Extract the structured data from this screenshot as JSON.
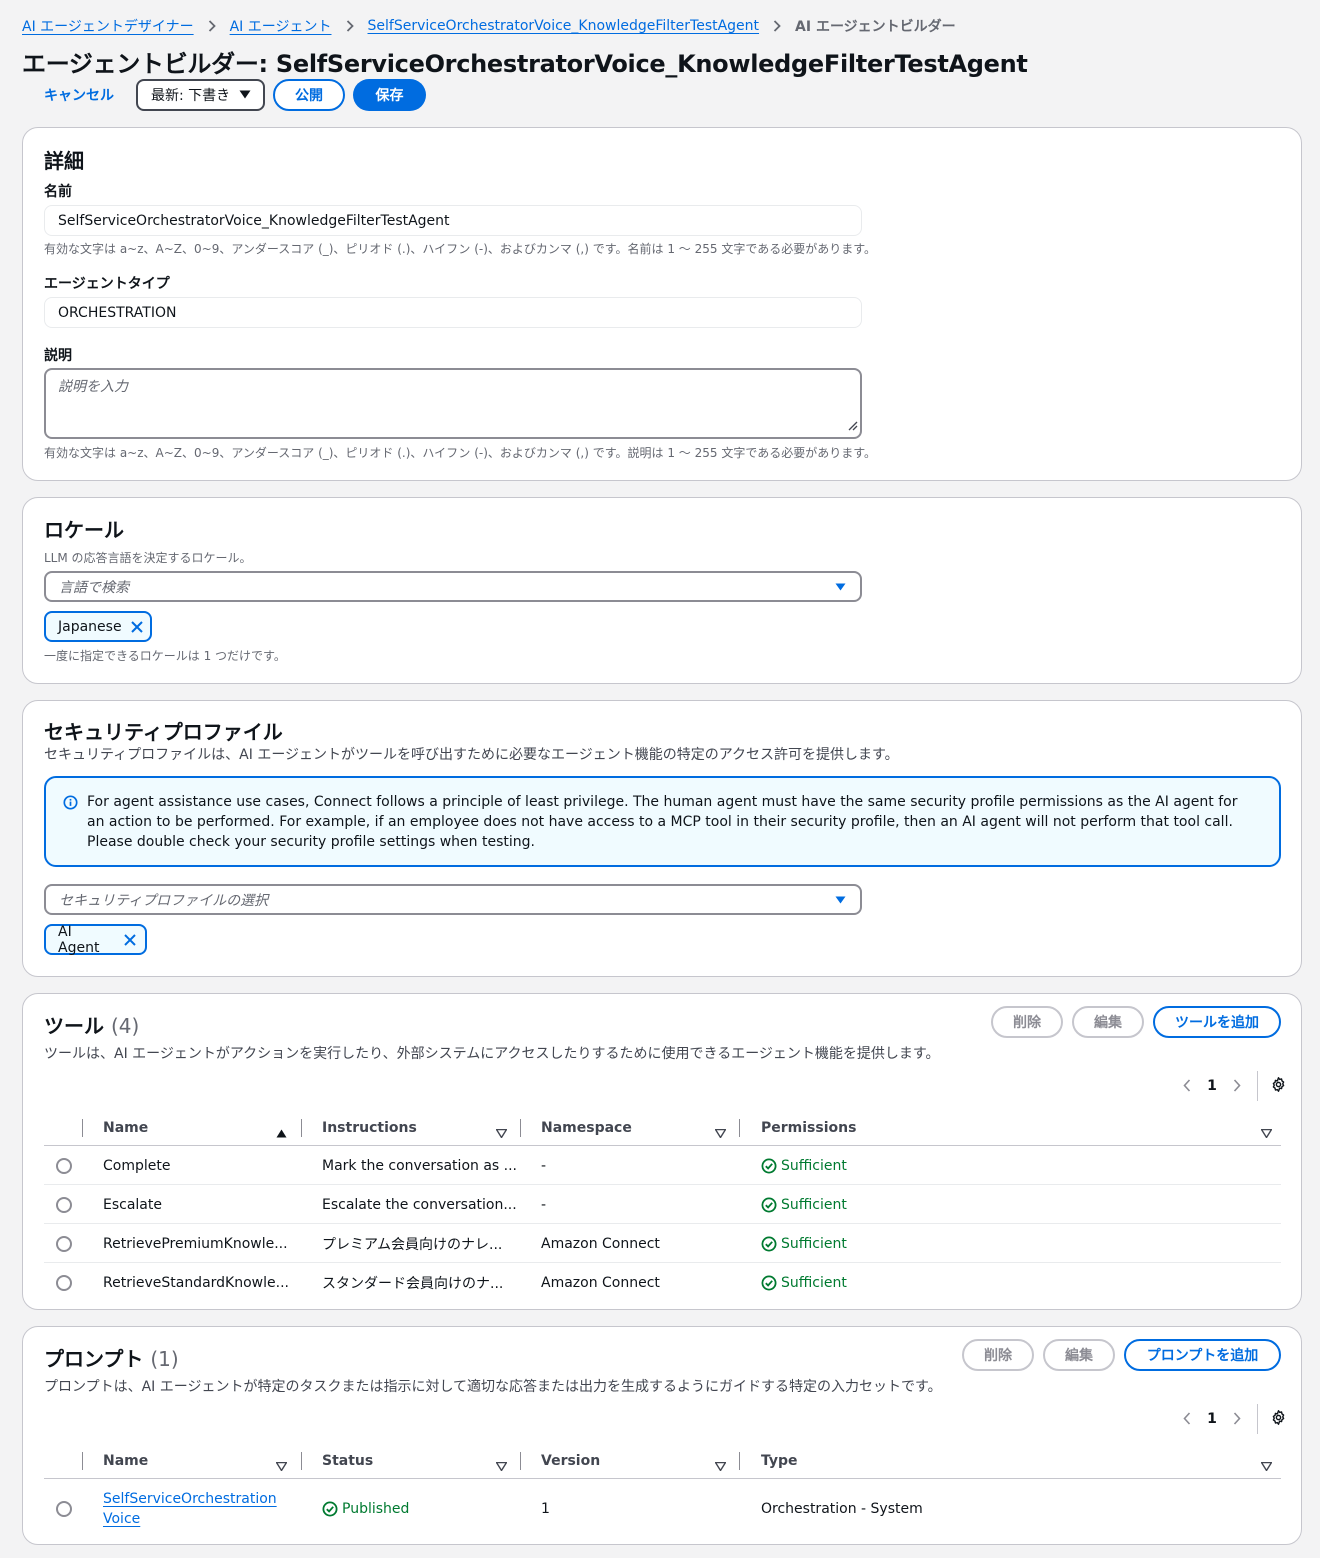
{
  "breadcrumb": {
    "items": [
      "AI エージェントデザイナー",
      "AI エージェント",
      "SelfServiceOrchestratorVoice_KnowledgeFilterTestAgent"
    ],
    "current": "AI エージェントビルダー"
  },
  "page": {
    "title": "エージェントビルダー: SelfServiceOrchestratorVoice_KnowledgeFilterTestAgent"
  },
  "actions": {
    "cancel": "キャンセル",
    "version_select": "最新: 下書き",
    "publish": "公開",
    "save": "保存"
  },
  "details": {
    "title": "詳細",
    "name_label": "名前",
    "name_value": "SelfServiceOrchestratorVoice_KnowledgeFilterTestAgent",
    "name_hint": "有効な文字は a~z、A~Z、0~9、アンダースコア (_)、ピリオド (.)、ハイフン (-)、およびカンマ (,) です。名前は 1 ～ 255 文字である必要があります。",
    "type_label": "エージェントタイプ",
    "type_value": "ORCHESTRATION",
    "desc_label": "説明",
    "desc_placeholder": "説明を入力",
    "desc_hint": "有効な文字は a~z、A~Z、0~9、アンダースコア (_)、ピリオド (.)、ハイフン (-)、およびカンマ (,) です。説明は 1 ～ 255 文字である必要があります。"
  },
  "locale": {
    "title": "ロケール",
    "description": "LLM の応答言語を決定するロケール。",
    "search_placeholder": "言語で検索",
    "selected": "Japanese",
    "hint": "一度に指定できるロケールは 1 つだけです。"
  },
  "security": {
    "title": "セキュリティプロファイル",
    "description": "セキュリティプロファイルは、AI エージェントがツールを呼び出すために必要なエージェント機能の特定のアクセス許可を提供します。",
    "info": "For agent assistance use cases, Connect follows a principle of least privilege. The human agent must have the same security profile permissions as the AI agent for an action to be performed. For example, if an employee does not have access to a MCP tool in their security profile, then an AI agent will not perform that tool call. Please double check your security profile settings when testing.",
    "select_placeholder": "セキュリティプロファイルの選択",
    "selected": "AI Agent"
  },
  "tools": {
    "title": "ツール",
    "count": "(4)",
    "description": "ツールは、AI エージェントがアクションを実行したり、外部システムにアクセスしたりするために使用できるエージェント機能を提供します。",
    "delete": "削除",
    "edit": "編集",
    "add": "ツールを追加",
    "page": "1",
    "columns": [
      "Name",
      "Instructions",
      "Namespace",
      "Permissions"
    ],
    "rows": [
      {
        "name": "Complete",
        "instructions": "Mark the conversation as ...",
        "namespace": "-",
        "permissions": "Sufficient"
      },
      {
        "name": "Escalate",
        "instructions": "Escalate the conversation...",
        "namespace": "-",
        "permissions": "Sufficient"
      },
      {
        "name": "RetrievePremiumKnowle...",
        "instructions": "プレミアム会員向けのナレ...",
        "namespace": "Amazon Connect",
        "permissions": "Sufficient"
      },
      {
        "name": "RetrieveStandardKnowle...",
        "instructions": "スタンダード会員向けのナ...",
        "namespace": "Amazon Connect",
        "permissions": "Sufficient"
      }
    ]
  },
  "prompts": {
    "title": "プロンプト",
    "count": "(1)",
    "description": "プロンプトは、AI エージェントが特定のタスクまたは指示に対して適切な応答または出力を生成するようにガイドする特定の入力セットです。",
    "delete": "削除",
    "edit": "編集",
    "add": "プロンプトを追加",
    "page": "1",
    "columns": [
      "Name",
      "Status",
      "Version",
      "Type"
    ],
    "rows": [
      {
        "name": "SelfServiceOrchestrationVoice",
        "status": "Published",
        "version": "1",
        "type": "Orchestration - System"
      }
    ]
  },
  "colors": {
    "link": "#006ce0",
    "success": "#007a30",
    "border": "#c6c6cd",
    "background": "#f3f3f4"
  }
}
